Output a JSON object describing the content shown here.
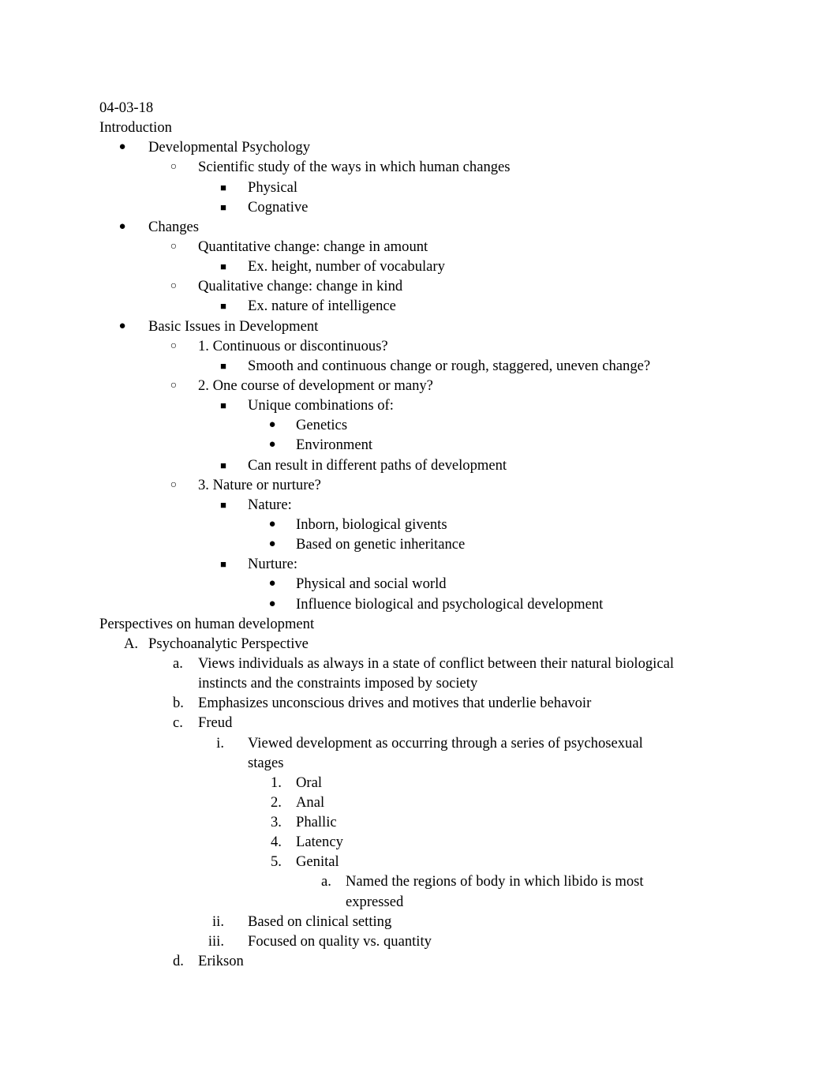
{
  "document": {
    "date": "04-03-18",
    "sections": [
      {
        "heading": "Introduction",
        "items": [
          {
            "level": 1,
            "marker": "●",
            "text": "Developmental Psychology"
          },
          {
            "level": 2,
            "marker": "○",
            "text": "Scientific study of the ways in which human changes"
          },
          {
            "level": 3,
            "marker": "■",
            "text": "Physical"
          },
          {
            "level": 3,
            "marker": "■",
            "text": "Cognative"
          },
          {
            "level": 1,
            "marker": "●",
            "text": "Changes"
          },
          {
            "level": 2,
            "marker": "○",
            "text": "Quantitative change: change in amount"
          },
          {
            "level": 3,
            "marker": "■",
            "text": "Ex. height, number of vocabulary"
          },
          {
            "level": 2,
            "marker": "○",
            "text": "Qualitative change: change in kind"
          },
          {
            "level": 3,
            "marker": "■",
            "text": "Ex. nature of intelligence"
          },
          {
            "level": 1,
            "marker": "●",
            "text": "Basic Issues in Development"
          },
          {
            "level": 2,
            "marker": "○",
            "text": "1. Continuous or discontinuous?"
          },
          {
            "level": 3,
            "marker": "■",
            "text": "Smooth and continuous change or rough, staggered, uneven change?"
          },
          {
            "level": 2,
            "marker": "○",
            "text": "2. One course of development or many?"
          },
          {
            "level": 3,
            "marker": "■",
            "text": "Unique combinations of:"
          },
          {
            "level": 4,
            "marker": "●",
            "text": "Genetics"
          },
          {
            "level": 4,
            "marker": "●",
            "text": "Environment"
          },
          {
            "level": 3,
            "marker": "■",
            "text": "Can result in different paths of development"
          },
          {
            "level": 2,
            "marker": "○",
            "text": "3. Nature or nurture?"
          },
          {
            "level": 3,
            "marker": "■",
            "text": "Nature:"
          },
          {
            "level": 4,
            "marker": "●",
            "text": "Inborn, biological givents"
          },
          {
            "level": 4,
            "marker": "●",
            "text": "Based on genetic inheritance"
          },
          {
            "level": 3,
            "marker": "■",
            "text": "Nurture:"
          },
          {
            "level": 4,
            "marker": "●",
            "text": "Physical and social world"
          },
          {
            "level": 4,
            "marker": "●",
            "text": "Influence biological and psychological development"
          }
        ]
      },
      {
        "heading": "Perspectives on human development",
        "items": [
          {
            "level": 1,
            "marker": "A.",
            "text": "Psychoanalytic Perspective"
          },
          {
            "level": 2,
            "marker": "a.",
            "text": "Views individuals as always in a state of conflict between their natural biological"
          },
          {
            "level": 2,
            "marker": "",
            "text": "instincts and the constraints imposed by society"
          },
          {
            "level": 2,
            "marker": "b.",
            "text": "Emphasizes unconscious drives and motives that underlie behavoir"
          },
          {
            "level": 2,
            "marker": "c.",
            "text": "Freud"
          },
          {
            "level": 3,
            "marker": "i.",
            "text": "Viewed development as occurring through a series of psychosexual"
          },
          {
            "level": 3,
            "marker": "",
            "text": "stages"
          },
          {
            "level": 4,
            "marker": "1.",
            "text": "Oral"
          },
          {
            "level": 4,
            "marker": "2.",
            "text": "Anal"
          },
          {
            "level": 4,
            "marker": "3.",
            "text": "Phallic"
          },
          {
            "level": 4,
            "marker": "4.",
            "text": "Latency"
          },
          {
            "level": 4,
            "marker": "5.",
            "text": "Genital"
          },
          {
            "level": 5,
            "marker": "a.",
            "text": "Named the regions of body in which libido is most"
          },
          {
            "level": 5,
            "marker": "",
            "text": "expressed"
          },
          {
            "level": 3,
            "marker": "ii.",
            "text": "Based on clinical setting"
          },
          {
            "level": 3,
            "marker": "iii.",
            "text": "Focused on quality vs. quantity"
          },
          {
            "level": 2,
            "marker": "d.",
            "text": "Erikson"
          }
        ]
      }
    ]
  }
}
